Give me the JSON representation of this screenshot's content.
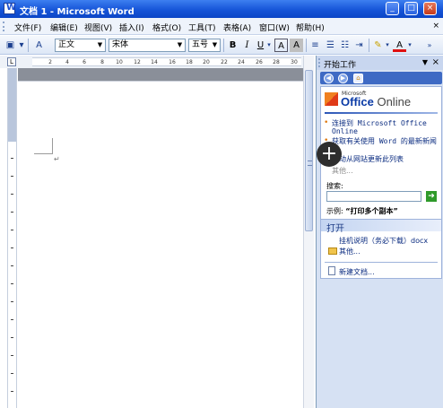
{
  "window": {
    "title": "文档 1 - Microsoft Word",
    "controls": [
      "_",
      "□",
      "×"
    ]
  },
  "menubar": {
    "items": [
      "文件(F)",
      "编辑(E)",
      "视图(V)",
      "插入(I)",
      "格式(O)",
      "工具(T)",
      "表格(A)",
      "窗口(W)",
      "帮助(H)"
    ],
    "close": "×"
  },
  "toolbar": {
    "style_combo": "正文",
    "font_combo": "宋体",
    "size_combo": "五号",
    "bold": "B",
    "italic": "I",
    "underline": "U",
    "char_border": "A",
    "char_shade": "A",
    "font_color": "A"
  },
  "ruler": {
    "numbers": [
      "2",
      "4",
      "6",
      "8",
      "10",
      "12",
      "14",
      "16",
      "18",
      "20",
      "22",
      "24",
      "26",
      "28",
      "30"
    ]
  },
  "document": {
    "paragraph_mark": "↵"
  },
  "taskpane": {
    "title": "开始工作",
    "office_online": {
      "small": "Microsoft",
      "brand": "Office",
      "brand2": "Online"
    },
    "links": [
      "连接到 Microsoft Office Online",
      "获取有关使用 Word 的最新新闻",
      "自动从网站更新此列表"
    ],
    "more": "其他...",
    "search_label": "搜索:",
    "search_value": "",
    "example_label": "示例:",
    "example_value": "“打印多个副本”",
    "open_title": "打开",
    "open_files": [
      "挂机说明（务必下载）docx",
      "其他..."
    ],
    "new_document": "新建文档..."
  },
  "overlay": {
    "plus": "+"
  },
  "colors": {
    "titlebar": "#1655d8",
    "taskpane": "#d6e1f3",
    "link": "#0b2c80",
    "bullet": "#e07b13"
  }
}
